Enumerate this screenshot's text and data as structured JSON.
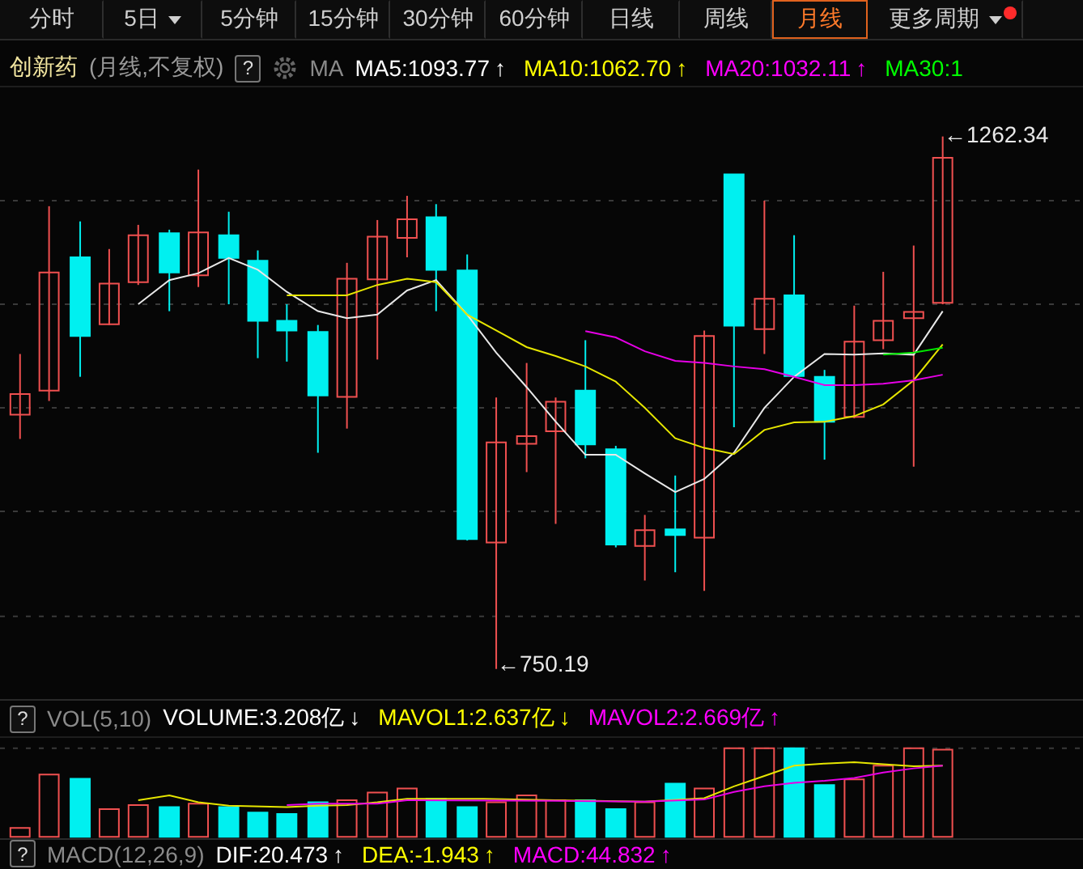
{
  "tabs": [
    {
      "label": "分时",
      "selected": false,
      "dropdown": false,
      "notification": false
    },
    {
      "label": "5日",
      "selected": false,
      "dropdown": true,
      "notification": false
    },
    {
      "label": "5分钟",
      "selected": false,
      "dropdown": false,
      "notification": false
    },
    {
      "label": "15分钟",
      "selected": false,
      "dropdown": false,
      "notification": false
    },
    {
      "label": "30分钟",
      "selected": false,
      "dropdown": false,
      "notification": false
    },
    {
      "label": "60分钟",
      "selected": false,
      "dropdown": false,
      "notification": false
    },
    {
      "label": "日线",
      "selected": false,
      "dropdown": false,
      "notification": false
    },
    {
      "label": "周线",
      "selected": false,
      "dropdown": false,
      "notification": false
    },
    {
      "label": "月线",
      "selected": true,
      "dropdown": false,
      "notification": false
    },
    {
      "label": "更多周期",
      "selected": false,
      "dropdown": true,
      "notification": true
    }
  ],
  "main_header": {
    "name": "创新药",
    "mode": "(月线,不复权)",
    "help": "?",
    "indicator": "MA",
    "values": [
      {
        "text": "MA5:1093.77",
        "arrow": "↑",
        "color": "#ffffff"
      },
      {
        "text": "MA10:1062.70",
        "arrow": "↑",
        "color": "#ffff00"
      },
      {
        "text": "MA20:1032.11",
        "arrow": "↑",
        "color": "#ff00ff"
      },
      {
        "text": "MA30:1",
        "color": "#00ff00"
      }
    ]
  },
  "price_chart": {
    "high_label": "←1262.34",
    "low_label": "←750.19"
  },
  "volume_header": {
    "help": "?",
    "indicator": "VOL(5,10)",
    "values": [
      {
        "text": "VOLUME:3.208亿",
        "arrow": "↓",
        "color": "#ffffff"
      },
      {
        "text": "MAVOL1:2.637亿",
        "arrow": "↓",
        "color": "#ffff00"
      },
      {
        "text": "MAVOL2:2.669亿",
        "arrow": "↑",
        "color": "#ff00ff"
      }
    ]
  },
  "macd_header": {
    "help": "?",
    "indicator": "MACD(12,26,9)",
    "values": [
      {
        "text": "DIF:20.473",
        "arrow": "↑",
        "color": "#ffffff"
      },
      {
        "text": "DEA:-1.943",
        "arrow": "↑",
        "color": "#ffff00"
      },
      {
        "text": "MACD:44.832",
        "arrow": "↑",
        "color": "#ff00ff"
      }
    ]
  }
}
